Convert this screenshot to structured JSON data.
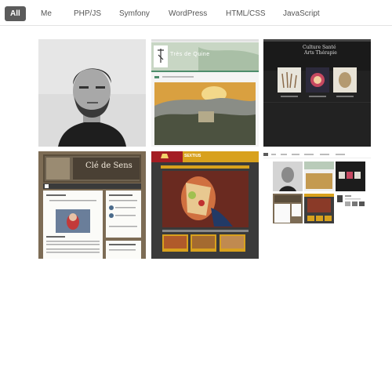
{
  "filters": [
    {
      "label": "All",
      "active": true
    },
    {
      "label": "Me"
    },
    {
      "label": "PHP/JS"
    },
    {
      "label": "Symfony"
    },
    {
      "label": "WordPress"
    },
    {
      "label": "HTML/CSS"
    },
    {
      "label": "JavaScript"
    }
  ],
  "thumbs": {
    "t2": {
      "site_title": "Très de Quine"
    },
    "t3": {
      "title_line1": "Culture Santé",
      "title_line2": "Arts Thérapie"
    },
    "t4": {
      "site_title": "Clé de Sens"
    },
    "t5": {
      "brand": "SEXTIUS"
    }
  },
  "colors": {
    "active_filter_bg": "#5b5b5b",
    "site_green": "#4e8d6c",
    "sextius_gold": "#d8a11d",
    "sextius_red": "#a41d23"
  }
}
